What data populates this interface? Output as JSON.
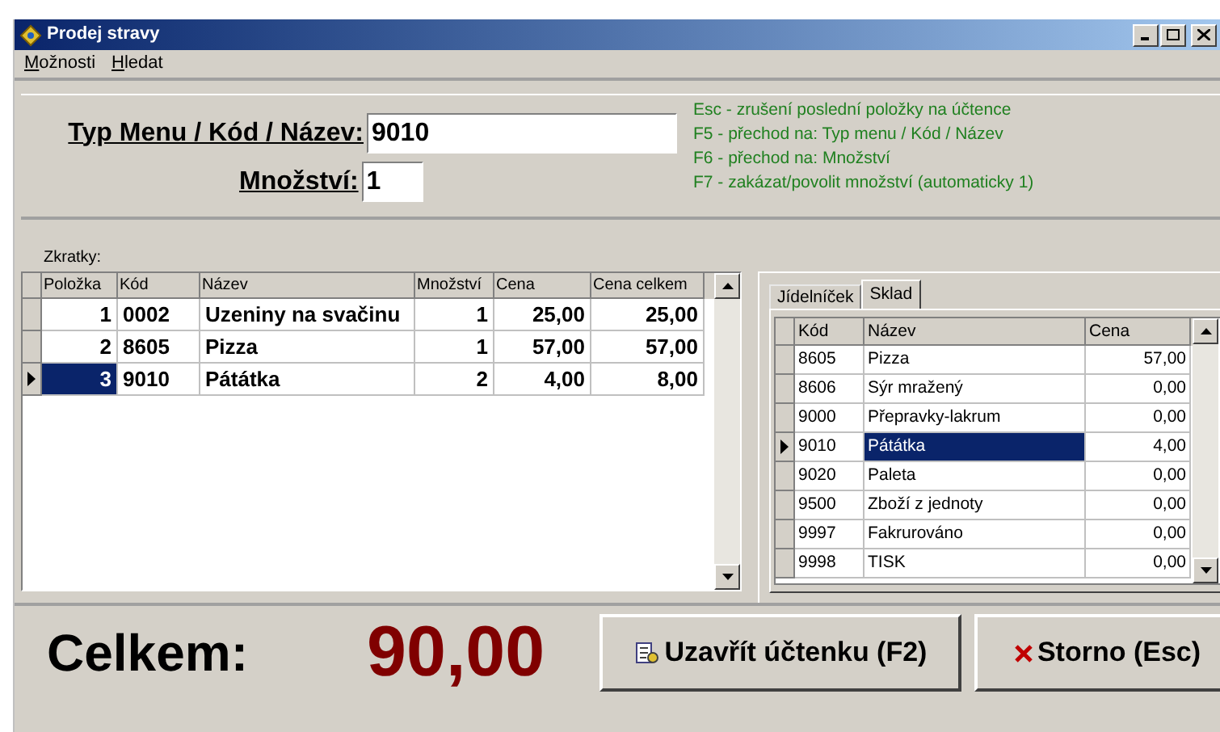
{
  "window": {
    "title": "Prodej stravy"
  },
  "menu": [
    "Možnosti",
    "Hledat"
  ],
  "entry": {
    "code_label": "Typ Menu / Kód / Název:",
    "code_value": "9010",
    "qty_label": "Množství:",
    "qty_value": "1"
  },
  "hints": [
    "Esc - zrušení poslední položky na účtence",
    "F5 - přechod na: Typ menu / Kód / Název",
    "F6 - přechod na: Množství",
    "F7 - zakázat/povolit množství (automaticky 1)"
  ],
  "shortcuts_label": "Zkratky:",
  "receipt": {
    "columns": [
      "Položka",
      "Kód",
      "Název",
      "Množství",
      "Cena",
      "Cena celkem"
    ],
    "rows": [
      {
        "cells": [
          "1",
          "0002",
          "Uzeniny na svačinu",
          "1",
          "25,00",
          "25,00"
        ],
        "selected": false
      },
      {
        "cells": [
          "2",
          "8605",
          "Pizza",
          "1",
          "57,00",
          "57,00"
        ],
        "selected": false
      },
      {
        "cells": [
          "3",
          "9010",
          "Pátátka",
          "2",
          "4,00",
          "8,00"
        ],
        "selected": true
      }
    ]
  },
  "tabs": [
    {
      "label": "Jídelníček",
      "selected": false
    },
    {
      "label": "Sklad",
      "selected": true
    }
  ],
  "stock": {
    "columns": [
      "Kód",
      "Název",
      "Cena"
    ],
    "rows": [
      {
        "cells": [
          "8605",
          "Pizza",
          "57,00"
        ],
        "selected": false
      },
      {
        "cells": [
          "8606",
          "Sýr mražený",
          "0,00"
        ],
        "selected": false
      },
      {
        "cells": [
          "9000",
          "Přepravky-lakrum",
          "0,00"
        ],
        "selected": false
      },
      {
        "cells": [
          "9010",
          "Pátátka",
          "4,00"
        ],
        "selected": true
      },
      {
        "cells": [
          "9020",
          "Paleta",
          "0,00"
        ],
        "selected": false
      },
      {
        "cells": [
          "9500",
          "Zboží z jednoty",
          "0,00"
        ],
        "selected": false
      },
      {
        "cells": [
          "9997",
          "Fakrurováno",
          "0,00"
        ],
        "selected": false
      },
      {
        "cells": [
          "9998",
          "TISK",
          "0,00"
        ],
        "selected": false
      }
    ]
  },
  "total": {
    "label": "Celkem:",
    "value": "90,00"
  },
  "buttons": [
    {
      "kind": "close",
      "label": "Uzavřít účtenku (F2)"
    },
    {
      "kind": "cancel",
      "label": "Storno (Esc)"
    }
  ]
}
